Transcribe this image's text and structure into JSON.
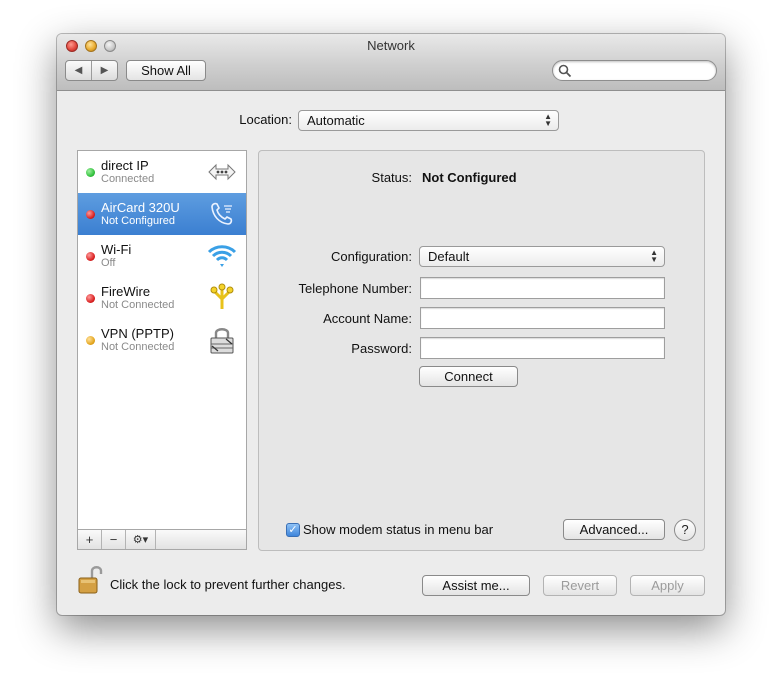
{
  "window": {
    "title": "Network"
  },
  "toolbar": {
    "back": "◀",
    "forward": "▶",
    "show_all_label": "Show All",
    "search_placeholder": "",
    "search_value": ""
  },
  "location": {
    "label": "Location:",
    "value": "Automatic"
  },
  "services": [
    {
      "name": "direct IP",
      "status": "Connected",
      "status_color": "#2fbf3a",
      "icon": "ethernet-icon",
      "selected": false
    },
    {
      "name": "AirCard 320U",
      "status": "Not Configured",
      "status_color": "#d91e1e",
      "icon": "phone-modem-icon",
      "selected": true
    },
    {
      "name": "Wi-Fi",
      "status": "Off",
      "status_color": "#d91e1e",
      "icon": "wifi-icon",
      "selected": false
    },
    {
      "name": "FireWire",
      "status": "Not Connected",
      "status_color": "#d91e1e",
      "icon": "firewire-icon",
      "selected": false
    },
    {
      "name": "VPN (PPTP)",
      "status": "Not Connected",
      "status_color": "#e3a41a",
      "icon": "vpn-lock-icon",
      "selected": false
    }
  ],
  "sidebar_controls": {
    "add": "+",
    "remove": "−",
    "gear": "⚙▾"
  },
  "detail": {
    "status_label": "Status:",
    "status_value": "Not Configured",
    "configuration_label": "Configuration:",
    "configuration_value": "Default",
    "telephone_label": "Telephone Number:",
    "telephone_value": "",
    "account_label": "Account Name:",
    "account_value": "",
    "password_label": "Password:",
    "password_value": "",
    "connect_label": "Connect",
    "modem_status_label": "Show modem status in menu bar",
    "modem_status_checked": true,
    "advanced_label": "Advanced...",
    "help_label": "?"
  },
  "footer": {
    "lock_text": "Click the lock to prevent further changes.",
    "assist_label": "Assist me...",
    "revert_label": "Revert",
    "apply_label": "Apply"
  },
  "colors": {
    "selection": "#3b7fd1",
    "window_bg": "#ececec"
  }
}
